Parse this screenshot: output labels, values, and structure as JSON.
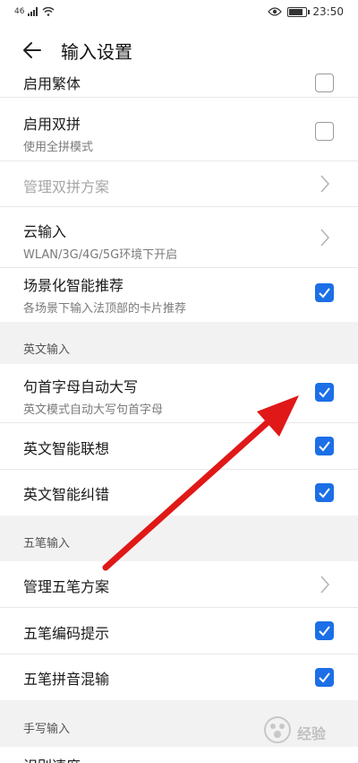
{
  "status": {
    "network": "46",
    "time": "23:50"
  },
  "header": {
    "title": "输入设置"
  },
  "items": {
    "traditional": {
      "title": "启用繁体",
      "checked": false
    },
    "double_pinyin": {
      "title": "启用双拼",
      "subtitle": "使用全拼模式",
      "checked": false
    },
    "manage_double_pinyin": {
      "title": "管理双拼方案"
    },
    "cloud_input": {
      "title": "云输入",
      "subtitle": "WLAN/3G/4G/5G环境下开启"
    },
    "scene_recommend": {
      "title": "场景化智能推荐",
      "subtitle": "各场景下输入法顶部的卡片推荐",
      "checked": true
    }
  },
  "english_section": {
    "header": "英文输入",
    "auto_cap": {
      "title": "句首字母自动大写",
      "subtitle": "英文模式自动大写句首字母",
      "checked": true
    },
    "smart_association": {
      "title": "英文智能联想",
      "checked": true
    },
    "smart_correction": {
      "title": "英文智能纠错",
      "checked": true
    }
  },
  "wubi_section": {
    "header": "五笔输入",
    "manage_wubi": {
      "title": "管理五笔方案"
    },
    "code_hint": {
      "title": "五笔编码提示",
      "checked": true
    },
    "pinyin_mix": {
      "title": "五笔拼音混输",
      "checked": true
    }
  },
  "handwriting_section": {
    "header": "手写输入",
    "recognition_speed": {
      "title": "识别速度"
    }
  },
  "watermark": {
    "text": "经验"
  },
  "colors": {
    "accent": "#1c6fe6",
    "section_bg": "#f2f2f2",
    "annotation_arrow": "#e01818"
  }
}
